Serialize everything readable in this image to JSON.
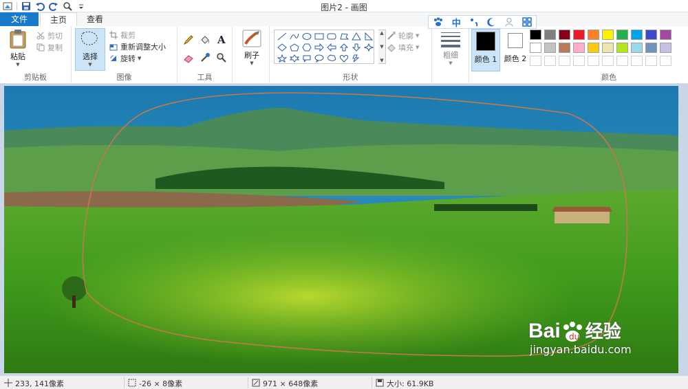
{
  "window": {
    "title": "图片2 - 画图"
  },
  "ime": {
    "mode": "中",
    "icons": [
      "paw-icon",
      "chinese-mode",
      "punctuation-icon",
      "moon-icon",
      "user-icon",
      "grid-icon"
    ]
  },
  "tabs": {
    "file": "文件",
    "home": "主页",
    "view": "查看"
  },
  "ribbon": {
    "clipboard": {
      "paste": "粘贴",
      "cut": "剪切",
      "copy": "复制",
      "label": "剪贴板"
    },
    "image": {
      "select": "选择",
      "crop": "裁剪",
      "resize": "重新调整大小",
      "rotate": "旋转",
      "label": "图像"
    },
    "tools": {
      "label": "工具"
    },
    "brushes": {
      "label": "刷子"
    },
    "shapes": {
      "outline": "轮廓",
      "fill": "填充",
      "label": "形状"
    },
    "size": {
      "label": "粗细"
    },
    "colors": {
      "color1": "颜色 1",
      "color2": "颜色 2",
      "label": "颜色",
      "color1_value": "#000000",
      "color2_value": "#ffffff",
      "palette": [
        "#000000",
        "#7f7f7f",
        "#880015",
        "#ed1c24",
        "#ff7f27",
        "#fff200",
        "#22b14c",
        "#00a2e8",
        "#3f48cc",
        "#a349a4",
        "#ffffff",
        "#c3c3c3",
        "#b97a57",
        "#ffaec9",
        "#ffc90e",
        "#efe4b0",
        "#b5e61d",
        "#99d9ea",
        "#7092be",
        "#c8bfe7",
        "#ffffff",
        "#ffffff",
        "#ffffff",
        "#ffffff",
        "#ffffff",
        "#ffffff",
        "#ffffff",
        "#ffffff",
        "#ffffff",
        "#ffffff"
      ]
    }
  },
  "status": {
    "cursor": "233, 141像素",
    "selection": "-26 × 8像素",
    "image_size": "971 × 648像素",
    "file_size": "大小: 61.9KB"
  },
  "watermark": {
    "brand": "Bai",
    "brand_suffix": "经验",
    "url": "jingyan.baidu.com"
  }
}
